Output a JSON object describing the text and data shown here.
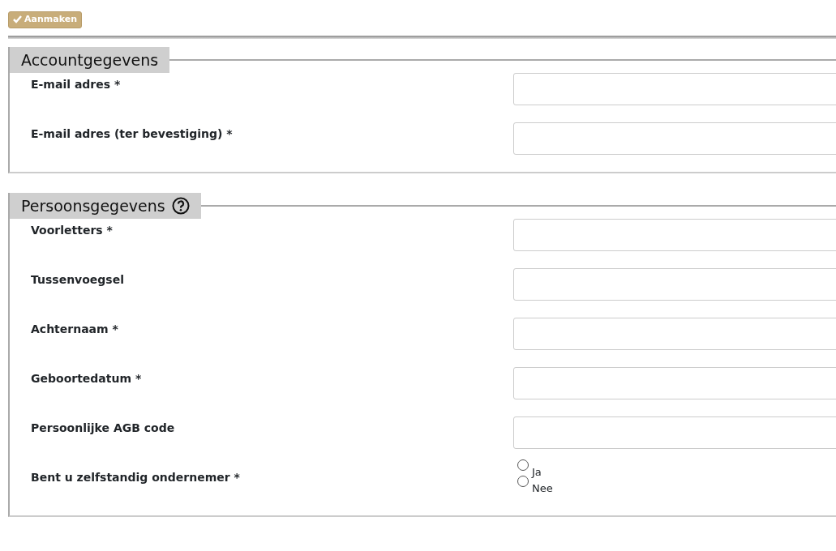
{
  "create_button": {
    "label": "Aanmaken"
  },
  "sections": [
    {
      "title": "Accountgegevens",
      "help": false,
      "fields": [
        {
          "kind": "text",
          "label": "E-mail adres *"
        },
        {
          "kind": "text",
          "label": "E-mail adres (ter bevestiging) *"
        }
      ]
    },
    {
      "title": "Persoonsgegevens",
      "help": true,
      "fields": [
        {
          "kind": "text",
          "label": "Voorletters *"
        },
        {
          "kind": "text",
          "label": "Tussenvoegsel"
        },
        {
          "kind": "text",
          "label": "Achternaam *"
        },
        {
          "kind": "text",
          "label": "Geboortedatum *"
        },
        {
          "kind": "text",
          "label": "Persoonlijke AGB code"
        },
        {
          "kind": "radio",
          "label": "Bent u zelfstandig ondernemer *",
          "options": [
            {
              "label": "Ja",
              "selected": false
            },
            {
              "label": "Nee",
              "selected": false
            }
          ]
        }
      ]
    }
  ]
}
